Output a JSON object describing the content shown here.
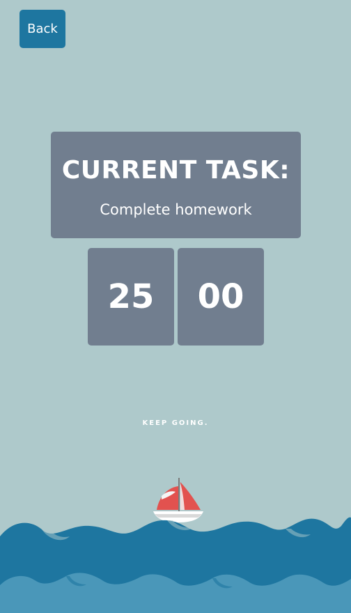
{
  "header": {
    "back_label": "Back"
  },
  "task": {
    "heading": "CURRENT TASK:",
    "name": "Complete homework"
  },
  "timer": {
    "minutes": "25",
    "seconds": "00"
  },
  "motto": "KEEP GOING.",
  "colors": {
    "background": "#aec9cb",
    "card": "#717e8f",
    "accent": "#1e76a0",
    "sail": "#e2524f",
    "sea_dark": "#1e76a0",
    "sea_light": "#4a97b9"
  },
  "decorations": {
    "boat_icon": "sailboat-icon",
    "waves_icon": "ocean-waves-icon"
  }
}
